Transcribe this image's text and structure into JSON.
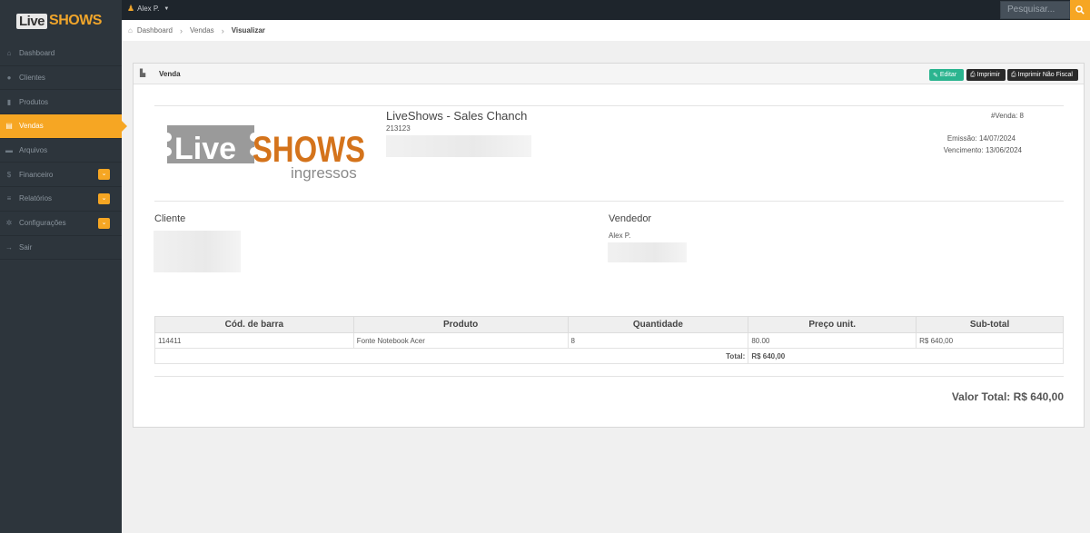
{
  "topbar": {
    "user_name": "Alex P.",
    "search_placeholder": "Pesquisar..."
  },
  "brand": {
    "logo_live": "Live",
    "logo_shows": "SHOWS"
  },
  "sidebar": {
    "items": [
      {
        "label": "Dashboard",
        "icon": "home-icon"
      },
      {
        "label": "Clientes",
        "icon": "users-icon"
      },
      {
        "label": "Produtos",
        "icon": "barcode-icon"
      },
      {
        "label": "Vendas",
        "icon": "cart-icon",
        "active": true
      },
      {
        "label": "Arquivos",
        "icon": "hdd-icon"
      },
      {
        "label": "Financeiro",
        "icon": "money-icon",
        "badge": true
      },
      {
        "label": "Relatórios",
        "icon": "list-icon",
        "badge": true
      },
      {
        "label": "Configurações",
        "icon": "gear-icon",
        "badge": true
      },
      {
        "label": "Sair",
        "icon": "signout-icon"
      }
    ]
  },
  "breadcrumb": {
    "home": "Dashboard",
    "section": "Vendas",
    "current": "Visualizar"
  },
  "panel": {
    "title": "Venda",
    "buttons": {
      "edit": "Editar",
      "print": "Imprimir",
      "print_nonfiscal": "Imprimir Não Fiscal"
    }
  },
  "company": {
    "name": "LiveShows - Sales Chanch",
    "id": "213123",
    "logo_live": "Live",
    "logo_shows": "SHOWS",
    "logo_tagline": "ingressos"
  },
  "sale": {
    "number_label": "#Venda: 8",
    "emission_label": "Emissão: 14/07/2024",
    "due_label": "Vencimento: 13/06/2024"
  },
  "client": {
    "title": "Cliente"
  },
  "seller": {
    "title": "Vendedor",
    "name": "Alex P."
  },
  "items_table": {
    "headers": [
      "Cód. de barra",
      "Produto",
      "Quantidade",
      "Preço unit.",
      "Sub-total"
    ],
    "rows": [
      [
        "114411",
        "Fonte Notebook Acer",
        "8",
        "80.00",
        "R$ 640,00"
      ]
    ],
    "total_label": "Total:",
    "total_value": "R$ 640,00"
  },
  "grand_total": "Valor Total: R$ 640,00",
  "colors": {
    "accent": "#f6a623",
    "sidebar_bg": "#2d353c",
    "topbar_bg": "#1e252c",
    "edit_button": "#2bb48f"
  }
}
